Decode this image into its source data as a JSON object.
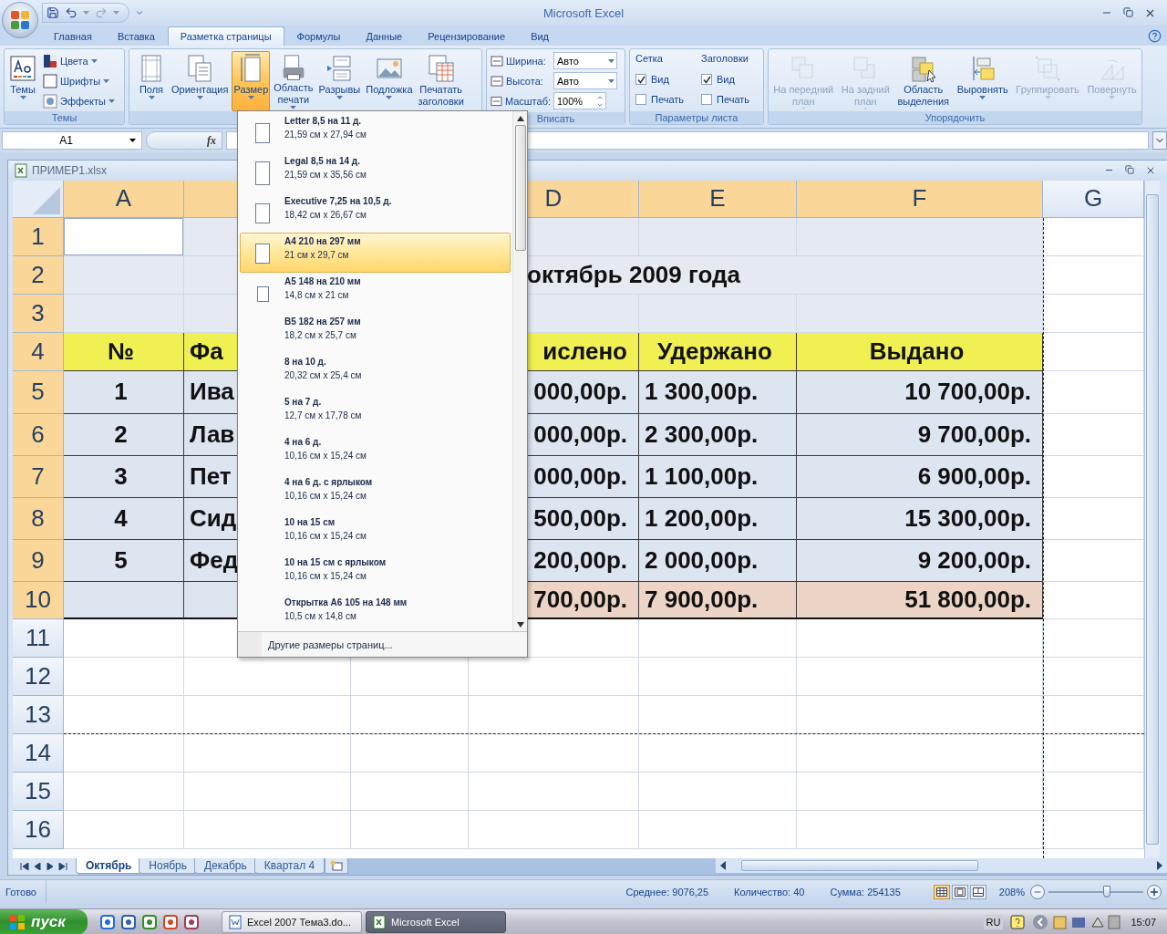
{
  "window": {
    "title": "Microsoft Excel"
  },
  "ribbon_tabs": [
    {
      "label": "Главная",
      "selected": false
    },
    {
      "label": "Вставка",
      "selected": false
    },
    {
      "label": "Разметка страницы",
      "selected": true
    },
    {
      "label": "Формулы",
      "selected": false
    },
    {
      "label": "Данные",
      "selected": false
    },
    {
      "label": "Рецензирование",
      "selected": false
    },
    {
      "label": "Вид",
      "selected": false
    }
  ],
  "themes_group": {
    "label": "Темы",
    "button": "Темы",
    "items": [
      "Цвета",
      "Шрифты",
      "Эффекты"
    ]
  },
  "page_setup": {
    "buttons": [
      {
        "lines": [
          "Поля"
        ],
        "selected": false
      },
      {
        "lines": [
          "Ориентация"
        ],
        "selected": false
      },
      {
        "lines": [
          "Размер"
        ],
        "selected": true
      },
      {
        "lines": [
          "Область",
          "печати"
        ],
        "selected": false
      },
      {
        "lines": [
          "Разрывы"
        ],
        "selected": false
      },
      {
        "lines": [
          "Подложка"
        ],
        "selected": false
      },
      {
        "lines": [
          "Печатать",
          "заголовки"
        ],
        "selected": false
      }
    ]
  },
  "fit_group": {
    "label": "Вписать",
    "rows": [
      {
        "label": "Ширина:",
        "value": "Авто",
        "kind": "dropdown"
      },
      {
        "label": "Высота:",
        "value": "Авто",
        "kind": "dropdown"
      },
      {
        "label": "Масштаб:",
        "value": "100%",
        "kind": "spinner"
      }
    ]
  },
  "sheet_options": {
    "label": "Параметры листа",
    "columns": [
      {
        "title": "Сетка",
        "options": [
          {
            "label": "Вид",
            "checked": true
          },
          {
            "label": "Печать",
            "checked": false
          }
        ]
      },
      {
        "title": "Заголовки",
        "options": [
          {
            "label": "Вид",
            "checked": true
          },
          {
            "label": "Печать",
            "checked": false
          }
        ]
      }
    ]
  },
  "arrange": {
    "label": "Упорядочить",
    "buttons": [
      {
        "lines": [
          "На передний",
          "план"
        ],
        "disabled": true
      },
      {
        "lines": [
          "На задний",
          "план"
        ],
        "disabled": true
      },
      {
        "lines": [
          "Область",
          "выделения"
        ],
        "disabled": false
      },
      {
        "lines": [
          "Выровнять"
        ],
        "disabled": false
      },
      {
        "lines": [
          "Группировать"
        ],
        "disabled": true
      },
      {
        "lines": [
          "Повернуть"
        ],
        "disabled": true
      }
    ]
  },
  "formula_bar": {
    "name_box": "A1",
    "function_label": "fx"
  },
  "workbook": {
    "title": "ПРИМЕР1.xlsx"
  },
  "sheet": {
    "columns": [
      {
        "label": "A",
        "highlighted": true
      },
      {
        "label": "D",
        "highlighted": true
      },
      {
        "label": "E",
        "highlighted": true
      },
      {
        "label": "F",
        "highlighted": true
      },
      {
        "label": "G",
        "highlighted": false
      }
    ],
    "rows": [
      {
        "header": "1",
        "highlighted": true,
        "kind": "band",
        "selected": true
      },
      {
        "header": "2",
        "highlighted": true,
        "kind": "band",
        "selected": false,
        "title": "октябрь 2009 года"
      },
      {
        "header": "3",
        "highlighted": true,
        "kind": "band",
        "selected": false
      },
      {
        "header": "4",
        "highlighted": true,
        "kind": "head",
        "selected": false,
        "cells": {
          "a": "№",
          "b": "Фа",
          "d": "ислено",
          "e": "Удержано",
          "f": "Выдано"
        }
      },
      {
        "header": "5",
        "highlighted": true,
        "kind": "data",
        "selected": false,
        "cells": {
          "a": "1",
          "b": "Ива",
          "d": "000,00р.",
          "e": "1 300,00р.",
          "f": "10 700,00р."
        }
      },
      {
        "header": "6",
        "highlighted": true,
        "kind": "data",
        "selected": false,
        "cells": {
          "a": "2",
          "b": "Лав",
          "d": "000,00р.",
          "e": "2 300,00р.",
          "f": "9 700,00р."
        }
      },
      {
        "header": "7",
        "highlighted": true,
        "kind": "data",
        "selected": false,
        "cells": {
          "a": "3",
          "b": "Пет",
          "d": "000,00р.",
          "e": "1 100,00р.",
          "f": "6 900,00р."
        }
      },
      {
        "header": "8",
        "highlighted": true,
        "kind": "data",
        "selected": false,
        "cells": {
          "a": "4",
          "b": "Сид",
          "d": "500,00р.",
          "e": "1 200,00р.",
          "f": "15 300,00р."
        }
      },
      {
        "header": "9",
        "highlighted": true,
        "kind": "data",
        "selected": false,
        "cells": {
          "a": "5",
          "b": "Фед",
          "d": "200,00р.",
          "e": "2 000,00р.",
          "f": "9 200,00р."
        }
      },
      {
        "header": "10",
        "highlighted": true,
        "kind": "total",
        "selected": false,
        "cells": {
          "d": "700,00р.",
          "e": "7 900,00р.",
          "f": "51 800,00р."
        }
      },
      {
        "header": "11",
        "highlighted": false,
        "kind": "empty",
        "selected": false
      },
      {
        "header": "12",
        "highlighted": false,
        "kind": "empty",
        "selected": false
      },
      {
        "header": "13",
        "highlighted": false,
        "kind": "empty",
        "selected": false
      },
      {
        "header": "14",
        "highlighted": false,
        "kind": "empty",
        "selected": false
      },
      {
        "header": "15",
        "highlighted": false,
        "kind": "empty",
        "selected": false
      },
      {
        "header": "16",
        "highlighted": false,
        "kind": "empty",
        "selected": false
      }
    ]
  },
  "size_menu": {
    "items": [
      {
        "name": "Letter 8,5 на 11 д.",
        "size": "21,59 см x 27,94 см",
        "kind": "page",
        "selected": false
      },
      {
        "name": "Legal 8,5 на 14 д.",
        "size": "21,59 см x 35,56 см",
        "kind": "tall_page",
        "selected": false
      },
      {
        "name": "Executive 7,25 на 10,5 д.",
        "size": "18,42 см x 26,67 см",
        "kind": "page",
        "selected": false
      },
      {
        "name": "A4 210 на 297 мм",
        "size": "21 см x 29,7 см",
        "kind": "page",
        "selected": true
      },
      {
        "name": "A5 148 на 210 мм",
        "size": "14,8 см x 21 см",
        "kind": "small_page",
        "selected": false
      },
      {
        "name": "B5 182 на 257 мм",
        "size": "18,2 см x 25,7 см",
        "kind": "none",
        "selected": false
      },
      {
        "name": "8 на 10 д.",
        "size": "20,32 см x 25,4 см",
        "kind": "none",
        "selected": false
      },
      {
        "name": "5 на 7 д.",
        "size": "12,7 см x 17,78 см",
        "kind": "none",
        "selected": false
      },
      {
        "name": "4 на 6 д.",
        "size": "10,16 см x 15,24 см",
        "kind": "none",
        "selected": false
      },
      {
        "name": "4 на 6 д. с ярлыком",
        "size": "10,16 см x 15,24 см",
        "kind": "none",
        "selected": false
      },
      {
        "name": "10 на 15 см",
        "size": "10,16 см x 15,24 см",
        "kind": "none",
        "selected": false
      },
      {
        "name": "10 на 15 см с ярлыком",
        "size": "10,16 см x 15,24 см",
        "kind": "none",
        "selected": false
      },
      {
        "name": "Открытка A6 105 на 148 мм",
        "size": "10,5 см x 14,8 см",
        "kind": "none",
        "selected": false
      }
    ],
    "footer": "Другие размеры страниц..."
  },
  "sheet_tabs": [
    {
      "label": "Октябрь",
      "selected": true
    },
    {
      "label": "Ноябрь",
      "selected": false
    },
    {
      "label": "Декабрь",
      "selected": false
    },
    {
      "label": "Квартал 4",
      "selected": false
    }
  ],
  "status_bar": {
    "status": "Готово",
    "stats": [
      "Среднее: 9076,25",
      "Количество: 40",
      "Сумма: 254135"
    ],
    "view_buttons": [
      {
        "selected": true
      },
      {
        "selected": false
      },
      {
        "selected": false
      }
    ],
    "zoom": {
      "reading": "208%",
      "level": 0.62
    }
  },
  "taskbar": {
    "start": "пуск",
    "tasks": [
      {
        "label": "Excel 2007 Тема3.do...",
        "kind": "word",
        "selected": false
      },
      {
        "label": "Microsoft Excel",
        "kind": "excel",
        "selected": true
      }
    ],
    "language": "RU",
    "clock": "15:07"
  }
}
